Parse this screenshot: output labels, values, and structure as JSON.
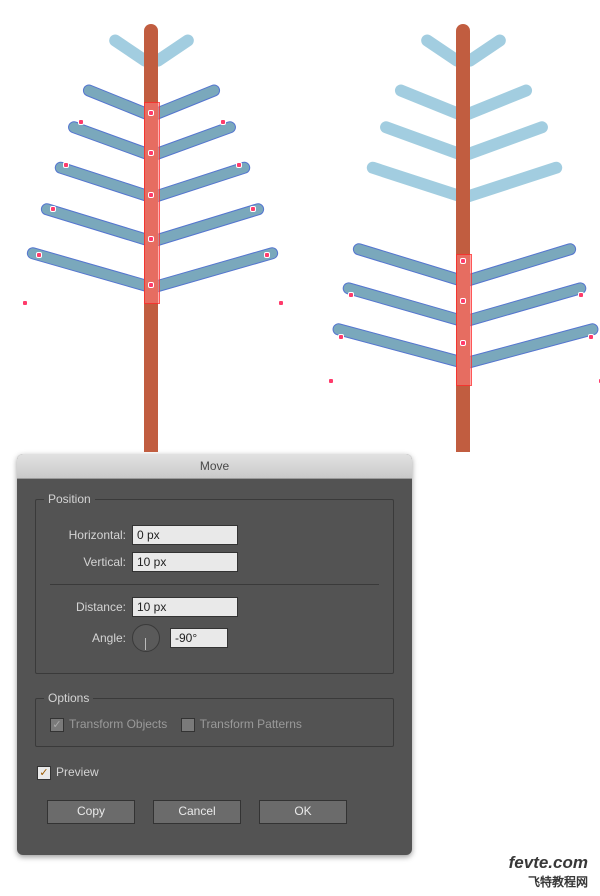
{
  "dialog": {
    "title": "Move",
    "position_label": "Position",
    "horizontal_label": "Horizontal:",
    "vertical_label": "Vertical:",
    "distance_label": "Distance:",
    "angle_label": "Angle:",
    "horizontal_value": "0 px",
    "vertical_value": "10 px",
    "distance_value": "10 px",
    "angle_value": "-90°",
    "options_label": "Options",
    "transform_objects_label": "Transform Objects",
    "transform_patterns_label": "Transform Patterns",
    "preview_label": "Preview",
    "copy_label": "Copy",
    "cancel_label": "Cancel",
    "ok_label": "OK"
  },
  "watermark": {
    "line1": "fevte.com",
    "line2": "飞特教程网"
  }
}
